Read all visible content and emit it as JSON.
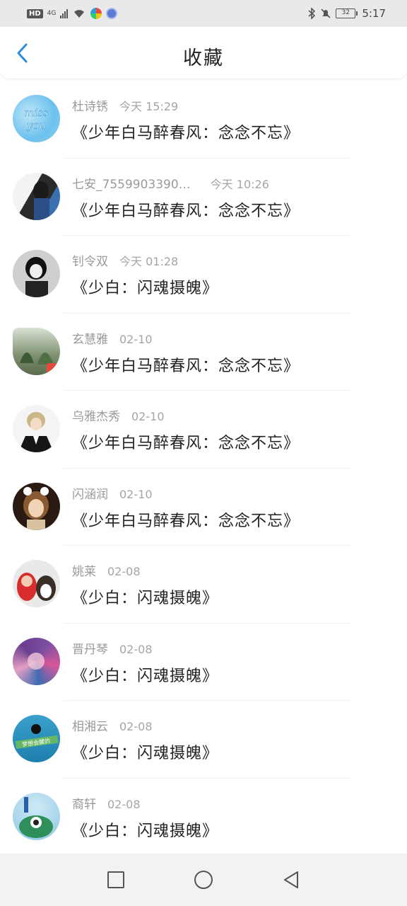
{
  "status_bar": {
    "hd": "HD",
    "network": "4G",
    "time": "5:17",
    "battery": "32"
  },
  "header": {
    "title": "收藏"
  },
  "favorites": [
    {
      "name": "杜诗锈",
      "time": "今天 15:29",
      "title": "《少年白马醉春风：念念不忘》",
      "avatar_text": "miss you"
    },
    {
      "name": "七安_7559903390…",
      "time": "今天 10:26",
      "title": "《少年白马醉春风：念念不忘》"
    },
    {
      "name": "钊令双",
      "time": "今天 01:28",
      "title": "《少白：闪魂摄魄》"
    },
    {
      "name": "玄慧雅",
      "time": "02-10",
      "title": "《少年白马醉春风：念念不忘》"
    },
    {
      "name": "乌雅杰秀",
      "time": "02-10",
      "title": "《少年白马醉春风：念念不忘》"
    },
    {
      "name": "闪涵润",
      "time": "02-10",
      "title": "《少年白马醉春风：念念不忘》"
    },
    {
      "name": "姚莱",
      "time": "02-08",
      "title": "《少白：闪魂摄魄》"
    },
    {
      "name": "晋丹琴",
      "time": "02-08",
      "title": "《少白：闪魂摄魄》"
    },
    {
      "name": "相湘云",
      "time": "02-08",
      "title": "《少白：闪魂摄魄》",
      "avatar_text": "梦想会醒的"
    },
    {
      "name": "裔轩",
      "time": "02-08",
      "title": "《少白：闪魂摄魄》"
    }
  ],
  "colors": {
    "accent": "#2a8fd8",
    "title_text": "#222222",
    "meta_text": "#9a9a9a"
  },
  "navbar": {
    "icons": [
      "square-icon",
      "circle-icon",
      "triangle-back-icon"
    ]
  }
}
